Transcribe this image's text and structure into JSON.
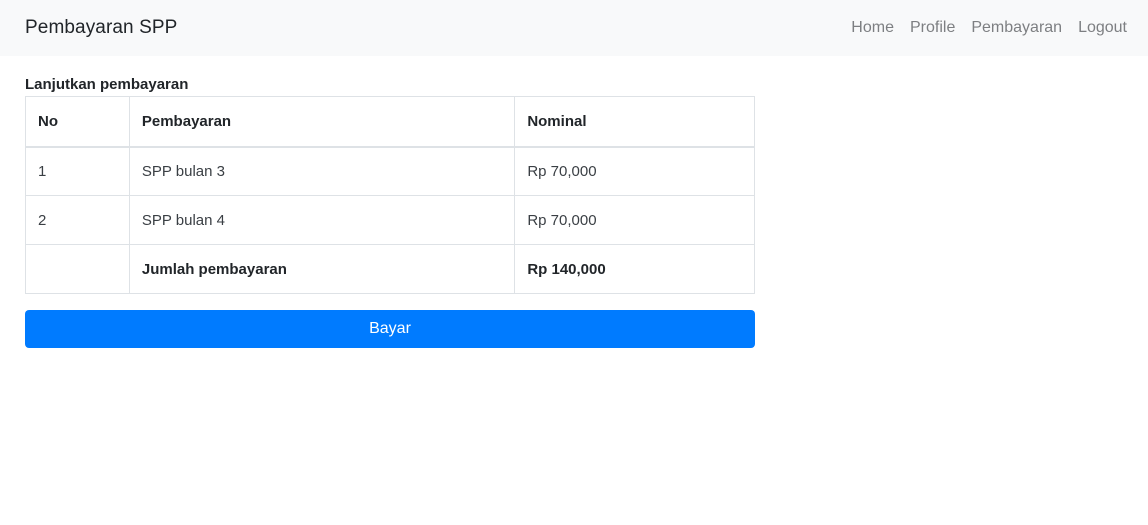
{
  "navbar": {
    "brand": "Pembayaran SPP",
    "links": [
      "Home",
      "Profile",
      "Pembayaran",
      "Logout"
    ]
  },
  "main": {
    "title": "Lanjutkan pembayaran",
    "table": {
      "headers": [
        "No",
        "Pembayaran",
        "Nominal"
      ],
      "rows": [
        [
          "1",
          "SPP bulan 3",
          "Rp 70,000"
        ],
        [
          "2",
          "SPP bulan 4",
          "Rp 70,000"
        ]
      ],
      "total": {
        "no": "",
        "label": "Jumlah pembayaran",
        "amount": "Rp 140,000"
      }
    },
    "pay_button": "Bayar"
  },
  "colors": {
    "navbar_bg": "#f8f9fa",
    "primary": "#007bff",
    "nav_link": "#7d7f82"
  }
}
